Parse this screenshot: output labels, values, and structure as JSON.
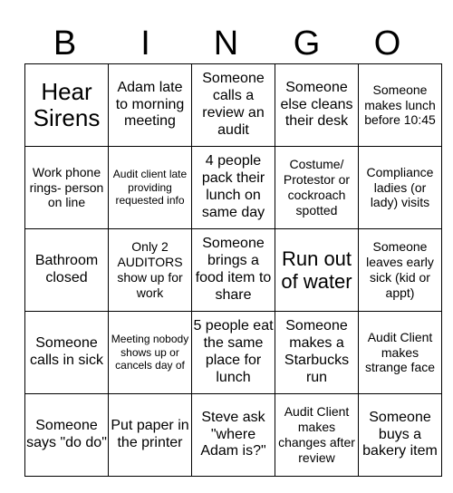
{
  "card": {
    "title_letters": [
      "B",
      "I",
      "N",
      "G",
      "O"
    ],
    "columns": 5,
    "rows": 5,
    "colors": {
      "background": "#ffffff",
      "text": "#000000",
      "grid_line": "#000000"
    }
  },
  "cells": [
    [
      {
        "text": "Hear Sirens",
        "size": "xl"
      },
      {
        "text": "Adam late to morning meeting",
        "size": "md"
      },
      {
        "text": "Someone calls a review an audit",
        "size": "md"
      },
      {
        "text": "Someone else cleans their desk",
        "size": "md"
      },
      {
        "text": "Someone makes lunch before 10:45",
        "size": "sm"
      }
    ],
    [
      {
        "text": "Work phone rings- person on line",
        "size": "sm"
      },
      {
        "text": "Audit client late providing requested info",
        "size": "xs"
      },
      {
        "text": "4 people pack their lunch on same day",
        "size": "md"
      },
      {
        "text": "Costume/ Protestor or cockroach spotted",
        "size": "sm"
      },
      {
        "text": "Compliance ladies (or lady) visits",
        "size": "sm"
      }
    ],
    [
      {
        "text": "Bathroom closed",
        "size": "md"
      },
      {
        "text": "Only 2 AUDITORS show up for work",
        "size": "sm"
      },
      {
        "text": "Someone brings a food item to share",
        "size": "md"
      },
      {
        "text": "Run out of water",
        "size": "lg"
      },
      {
        "text": "Someone leaves early sick (kid or appt)",
        "size": "sm"
      }
    ],
    [
      {
        "text": "Someone calls in sick",
        "size": "md"
      },
      {
        "text": "Meeting nobody shows up or cancels day of",
        "size": "xs"
      },
      {
        "text": "5 people eat the same place for lunch",
        "size": "md"
      },
      {
        "text": "Someone makes a Starbucks run",
        "size": "md"
      },
      {
        "text": "Audit Client makes strange face",
        "size": "sm"
      }
    ],
    [
      {
        "text": "Someone says \"do do\"",
        "size": "md"
      },
      {
        "text": "Put paper in the printer",
        "size": "md"
      },
      {
        "text": "Steve ask \"where Adam is?\"",
        "size": "md"
      },
      {
        "text": "Audit Client makes changes after review",
        "size": "sm"
      },
      {
        "text": "Someone buys a bakery item",
        "size": "md"
      }
    ]
  ]
}
